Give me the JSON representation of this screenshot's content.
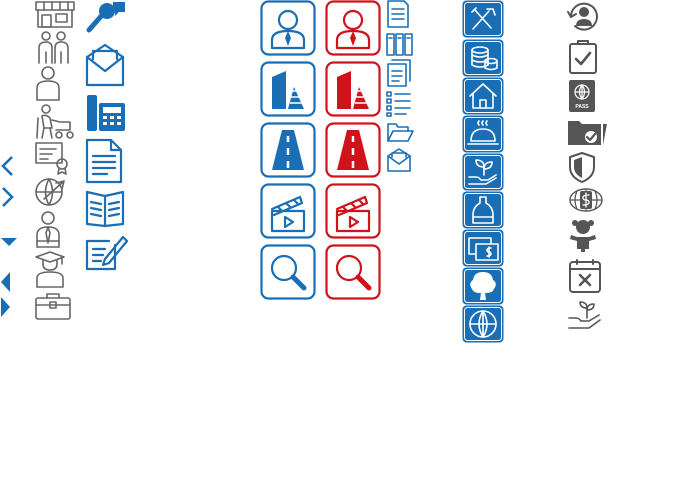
{
  "colors": {
    "blue": "#1a6eb5",
    "red": "#d0121b",
    "gray": "#666666",
    "dark_gray": "#555555"
  },
  "passport_label": "PASS",
  "nav_arrows": [
    "chevron-left-icon",
    "chevron-right-icon",
    "caret-down-icon",
    "caret-left-icon",
    "caret-right-icon"
  ],
  "columns": {
    "gray_line_icons": [
      "store-icon",
      "family-icon",
      "person-icon",
      "elderly-walker-icon",
      "certificate-icon",
      "globe-plane-icon",
      "businessman-icon",
      "graduate-icon",
      "briefcase-icon"
    ],
    "blue_line_icons": [
      "microphone-chat-icon",
      "envelope-icon",
      "calculator-phone-icon",
      "document-icon",
      "open-book-icon",
      "edit-note-icon"
    ],
    "outline_pairs": [
      "user-icon",
      "buildings-icon",
      "road-icon",
      "clapperboard-icon",
      "search-icon"
    ],
    "small_blue_icons": [
      "document-icon",
      "binders-icon",
      "copy-icon",
      "list-icon",
      "folder-open-icon",
      "envelope-open-icon"
    ],
    "blue_tile_icons": [
      "tools-icon",
      "coins-icon",
      "house-icon",
      "food-service-icon",
      "plant-hand-icon",
      "bottle-icon",
      "payment-card-icon",
      "tree-icon",
      "global-community-icon"
    ],
    "dark_gray_icons": [
      "user-refresh-icon",
      "clipboard-check-icon",
      "passport-icon",
      "folder-check-icon",
      "shield-icon",
      "money-globe-icon",
      "child-icon",
      "calendar-cancel-icon",
      "hand-sprout-icon"
    ]
  }
}
